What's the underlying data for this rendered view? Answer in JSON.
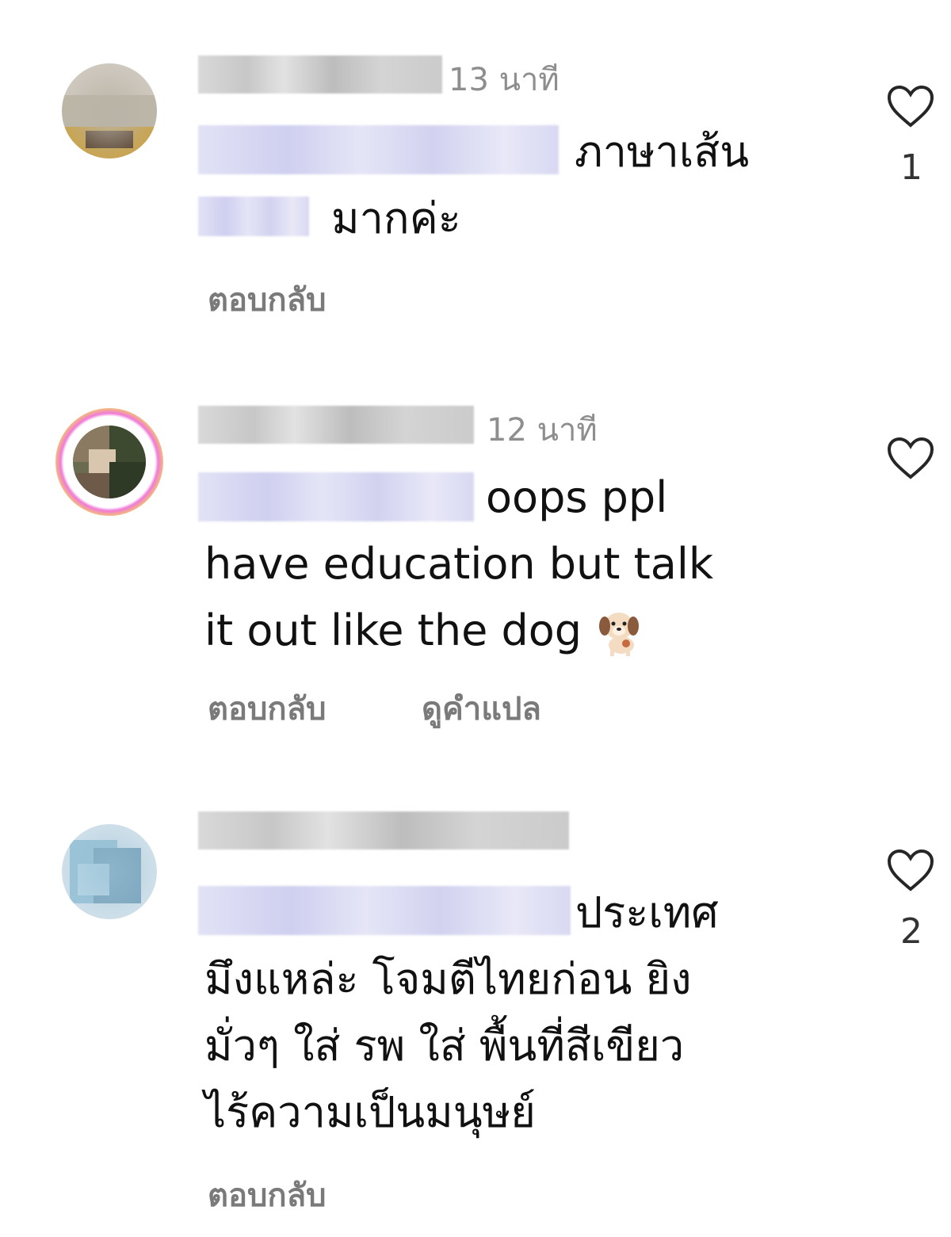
{
  "comments": [
    {
      "time": "13 นาที",
      "text_line1": "ภาษาเส้น",
      "text_line2": "มากค่ะ",
      "reply_label": "ตอบกลับ",
      "likes": "1"
    },
    {
      "time": "12 นาที",
      "text_line1": "oops ppl",
      "text_line2": "have education but talk",
      "text_line3": "it out like the dog",
      "reply_label": "ตอบกลับ",
      "translate_label": "ดูคำแปล",
      "likes": ""
    },
    {
      "time": "",
      "text_line1": "ประเทศ",
      "text_line2": "มึงแหล่ะ โจมตีไทยก่อน ยิง",
      "text_line3": "มั่วๆ ใส่ รพ ใส่ พื้นที่สีเขียว",
      "text_line4": "ไร้ความเป็นมนุษย์",
      "reply_label": "ตอบกลับ",
      "likes": "2"
    }
  ],
  "icons": {
    "heart": "heart-icon",
    "dog": "dog-emoji-icon"
  },
  "colors": {
    "meta_gray": "#8e8e8e",
    "action_gray": "#7a7a7a",
    "mention_blur": "#d8d8f2"
  }
}
